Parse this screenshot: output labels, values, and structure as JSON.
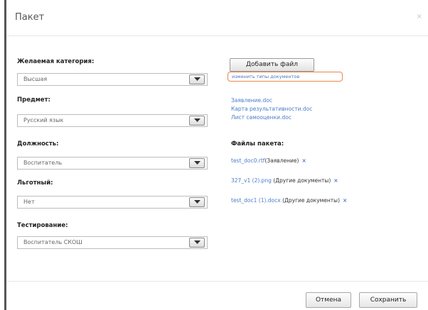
{
  "dialog": {
    "title": "Пакет",
    "close": "×"
  },
  "form": {
    "category": {
      "label": "Желаемая категория:",
      "value": "Высшая"
    },
    "subject": {
      "label": "Предмет:",
      "value": "Русский язык"
    },
    "position": {
      "label": "Должность:",
      "value": "Воспитатель"
    },
    "preferential": {
      "label": "Льготный:",
      "value": "Нет"
    },
    "testing": {
      "label": "Тестирование:",
      "value": "Воспитатель СКОШ"
    }
  },
  "files": {
    "add_button": "Добавить файл",
    "change_types_link": "изменить типы документов",
    "templates": [
      "Заявление.doc",
      "Карта результативности.doc",
      "Лист самооценки.doc"
    ],
    "heading": "Файлы пакета:",
    "items": [
      {
        "name": "test_doc0.rtf",
        "type": "(Заявление)",
        "delete": "×"
      },
      {
        "name": "327_v1 (2).png",
        "type": "(Другие документы)",
        "delete": "×"
      },
      {
        "name": "test_doc1 (1).docx",
        "type": "(Другие документы)",
        "delete": "×"
      }
    ]
  },
  "footer": {
    "cancel": "Отмена",
    "save": "Сохранить"
  }
}
